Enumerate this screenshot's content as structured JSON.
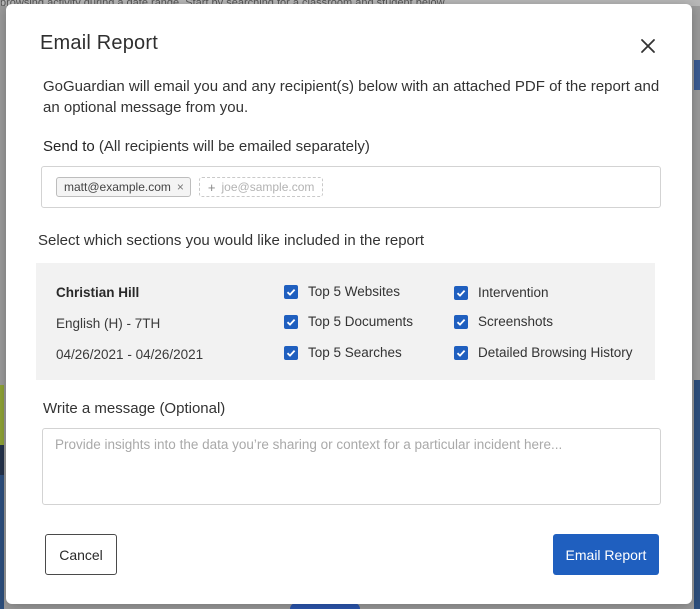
{
  "background": {
    "banner_text": "browsing activity during a date range. Start by searching for a classroom and student below."
  },
  "modal": {
    "title": "Email Report",
    "intro": "GoGuardian will email you and any recipient(s) below with an attached PDF of the report and an optional message from you.",
    "send_to": {
      "label": "Send to",
      "hint": "(All recipients will be emailed separately)",
      "recipients": [
        "matt@example.com"
      ],
      "remove_glyph": "×",
      "add_placeholder": "joe@sample.com",
      "add_glyph": "+"
    },
    "sections": {
      "label": "Select which sections you would like included in the report",
      "student_name": "Christian Hill",
      "class_name": "English (H) - 7TH",
      "date_range": "04/26/2021 - 04/26/2021",
      "options": [
        {
          "label": "Top 5 Websites",
          "checked": true
        },
        {
          "label": "Top 5 Documents",
          "checked": true
        },
        {
          "label": "Top 5 Searches",
          "checked": true
        },
        {
          "label": "Intervention",
          "checked": true
        },
        {
          "label": "Screenshots",
          "checked": true
        },
        {
          "label": "Detailed Browsing History",
          "checked": true
        }
      ]
    },
    "message": {
      "label": "Write a message",
      "optional": "(Optional)",
      "placeholder": "Provide insights into the data you’re sharing or context for a particular incident here..."
    },
    "buttons": {
      "cancel": "Cancel",
      "submit": "Email Report"
    }
  },
  "colors": {
    "accent": "#1f5fbf",
    "border": "#d3d3d3",
    "panel": "#f2f2f2"
  }
}
